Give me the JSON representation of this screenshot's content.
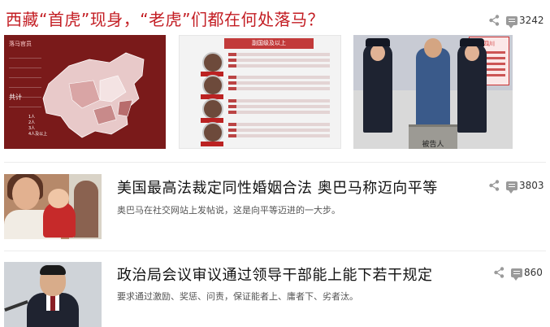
{
  "top_story": {
    "title": "西藏“首虎”现身，“老虎”们都在何处落马？",
    "comment_count": "3242",
    "gallery": [
      {
        "type": "map",
        "map_title": "落马官员",
        "total_label": "共计",
        "legend": [
          "1人",
          "2人",
          "3人",
          "4人及以上"
        ]
      },
      {
        "type": "list",
        "header": "副国级及以上"
      },
      {
        "type": "photo",
        "region_label": "四川",
        "dock_label": "被告人"
      }
    ]
  },
  "items": [
    {
      "title": "美国最高法裁定同性婚姻合法 奥巴马称迈向平等",
      "summary": "奥巴马在社交网站上发帖说，这是向平等迈进的一大步。",
      "comment_count": "3803"
    },
    {
      "title": "政治局会议审议通过领导干部能上能下若干规定",
      "summary": "要求通过激励、奖惩、问责，保证能者上、庸者下、劣者汰。",
      "comment_count": "860"
    }
  ],
  "icons": {
    "share": "share-icon",
    "comment": "comment-icon"
  },
  "colors": {
    "headline_red": "#c31d23",
    "text": "#111111",
    "muted": "#555555"
  }
}
